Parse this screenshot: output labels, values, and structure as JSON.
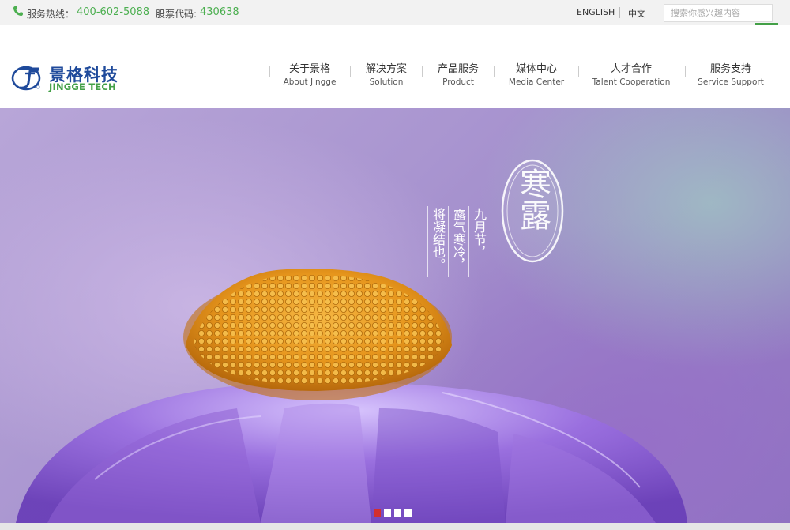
{
  "topbar": {
    "hotline_label": "服务热线：",
    "hotline_value": "400-602-5088",
    "stock_label": "股票代码:",
    "stock_value": "430638",
    "lang_en": "ENGLISH",
    "lang_cn": "中文",
    "search_placeholder": "搜索你感兴趣内容"
  },
  "logo": {
    "cn": "景格科技",
    "en": "JINGGE TECH"
  },
  "nav": {
    "items": [
      {
        "cn": "关于景格",
        "en": "About Jingge"
      },
      {
        "cn": "解决方案",
        "en": "Solution"
      },
      {
        "cn": "产品服务",
        "en": "Product"
      },
      {
        "cn": "媒体中心",
        "en": "Media Center"
      },
      {
        "cn": "人才合作",
        "en": "Talent Cooperation"
      },
      {
        "cn": "服务支持",
        "en": "Service Support"
      }
    ]
  },
  "hero": {
    "seal_text": "寒露",
    "poem_col1": "九月节，",
    "poem_col2": "露气寒冷，",
    "poem_col3": "将凝结也。"
  },
  "slider": {
    "count": 4,
    "active_index": 0
  },
  "colors": {
    "accent_green": "#43a047",
    "brand_blue": "#1f4a9b",
    "dot_active": "#d32f2f"
  }
}
